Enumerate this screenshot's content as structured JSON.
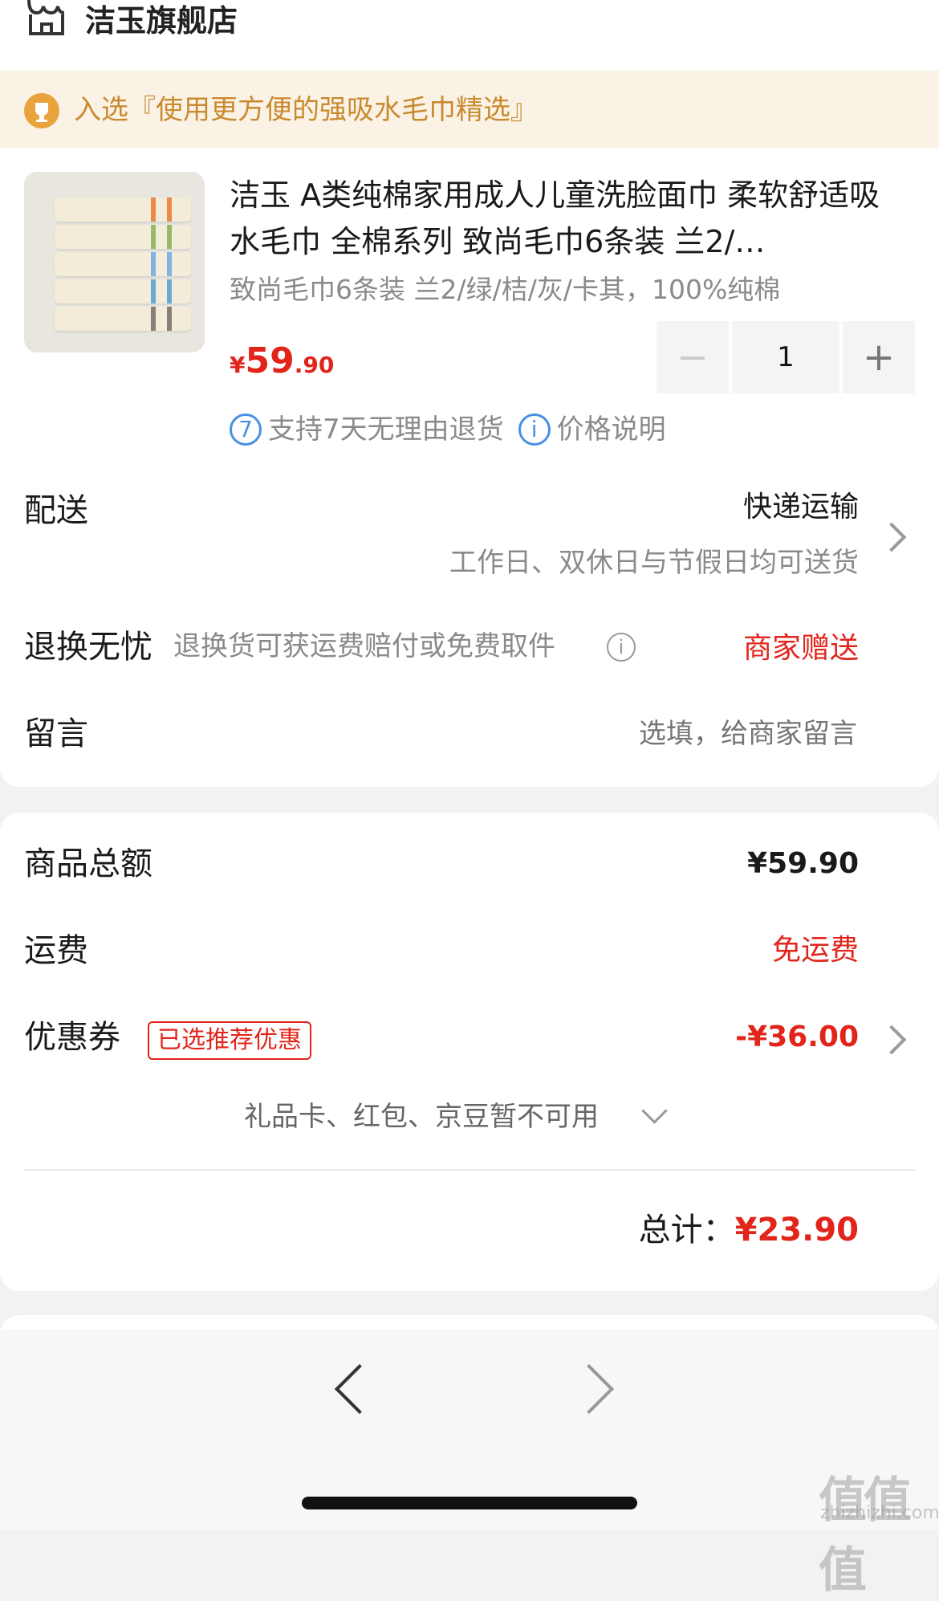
{
  "store": {
    "name": "洁玉旗舰店"
  },
  "banner": {
    "text": "入选『使用更方便的强吸水毛巾精选』"
  },
  "product": {
    "title": "洁玉 A类纯棉家用成人儿童洗脸面巾 柔软舒适吸水毛巾 全棉系列 致尚毛巾6条装 兰2/…",
    "spec": "致尚毛巾6条装 兰2/绿/桔/灰/卡其，100%纯棉",
    "price_currency": "¥",
    "price_int": "59",
    "price_dec": ".90",
    "quantity": "1",
    "minus": "−",
    "plus": "+",
    "badge_return_icon": "7",
    "badge_return": "支持7天无理由退货",
    "badge_price_icon": "i",
    "badge_price": "价格说明"
  },
  "delivery": {
    "label": "配送",
    "method": "快递运输",
    "note": "工作日、双休日与节假日均可送货"
  },
  "returns": {
    "label": "退换无忧",
    "desc": "退换货可获运费赔付或免费取件",
    "info_icon": "i",
    "value": "商家赠送"
  },
  "message": {
    "label": "留言",
    "placeholder": "选填，给商家留言"
  },
  "summary": {
    "goods_label": "商品总额",
    "goods_value": "¥59.90",
    "shipping_label": "运费",
    "shipping_value": "免运费",
    "coupon_label": "优惠券",
    "coupon_tag": "已选推荐优惠",
    "coupon_value": "-¥36.00",
    "gift_note": "礼品卡、红包、京豆暂不可用",
    "total_label": "总计：",
    "total_value": "¥23.90"
  },
  "watermark": {
    "main": "值值值",
    "domain": "zhizhizhi.com"
  },
  "colors": {
    "accent_red": "#e1251b",
    "banner_bg": "#fbf2e6",
    "banner_text": "#c98a2e",
    "info_blue": "#4a90e2"
  }
}
